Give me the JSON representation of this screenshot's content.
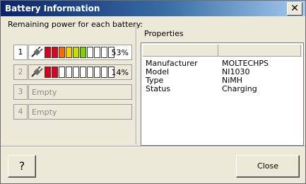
{
  "window": {
    "title": "Battery Information"
  },
  "left": {
    "label": "Remaining power for each battery:"
  },
  "batteries": [
    {
      "num": "1",
      "percent": "53%",
      "level": 0.53,
      "cells": [
        "#d9001a",
        "#e00020",
        "#ff6a00",
        "#ffcc00",
        "#c8e000",
        "#7fd100",
        "#ffffff",
        "#ffffff",
        "#ffffff",
        "#ffffff"
      ]
    },
    {
      "num": "2",
      "percent": "14%",
      "level": 0.14,
      "cells": [
        "#d9001a",
        "#e00020",
        "#ffffff",
        "#ffffff",
        "#ffffff",
        "#ffffff",
        "#ffffff",
        "#ffffff",
        "#ffffff",
        "#ffffff"
      ]
    },
    {
      "num": "3",
      "status": "Empty"
    },
    {
      "num": "4",
      "status": "Empty"
    }
  ],
  "properties": {
    "label": "Properties",
    "rows": [
      {
        "name": "Manufacturer",
        "value": "MOLTECHPS"
      },
      {
        "name": "Model",
        "value": "NI1030"
      },
      {
        "name": "Type",
        "value": "NiMH"
      },
      {
        "name": "Status",
        "value": "Charging"
      }
    ]
  },
  "buttons": {
    "help": "?",
    "close": "Close"
  }
}
